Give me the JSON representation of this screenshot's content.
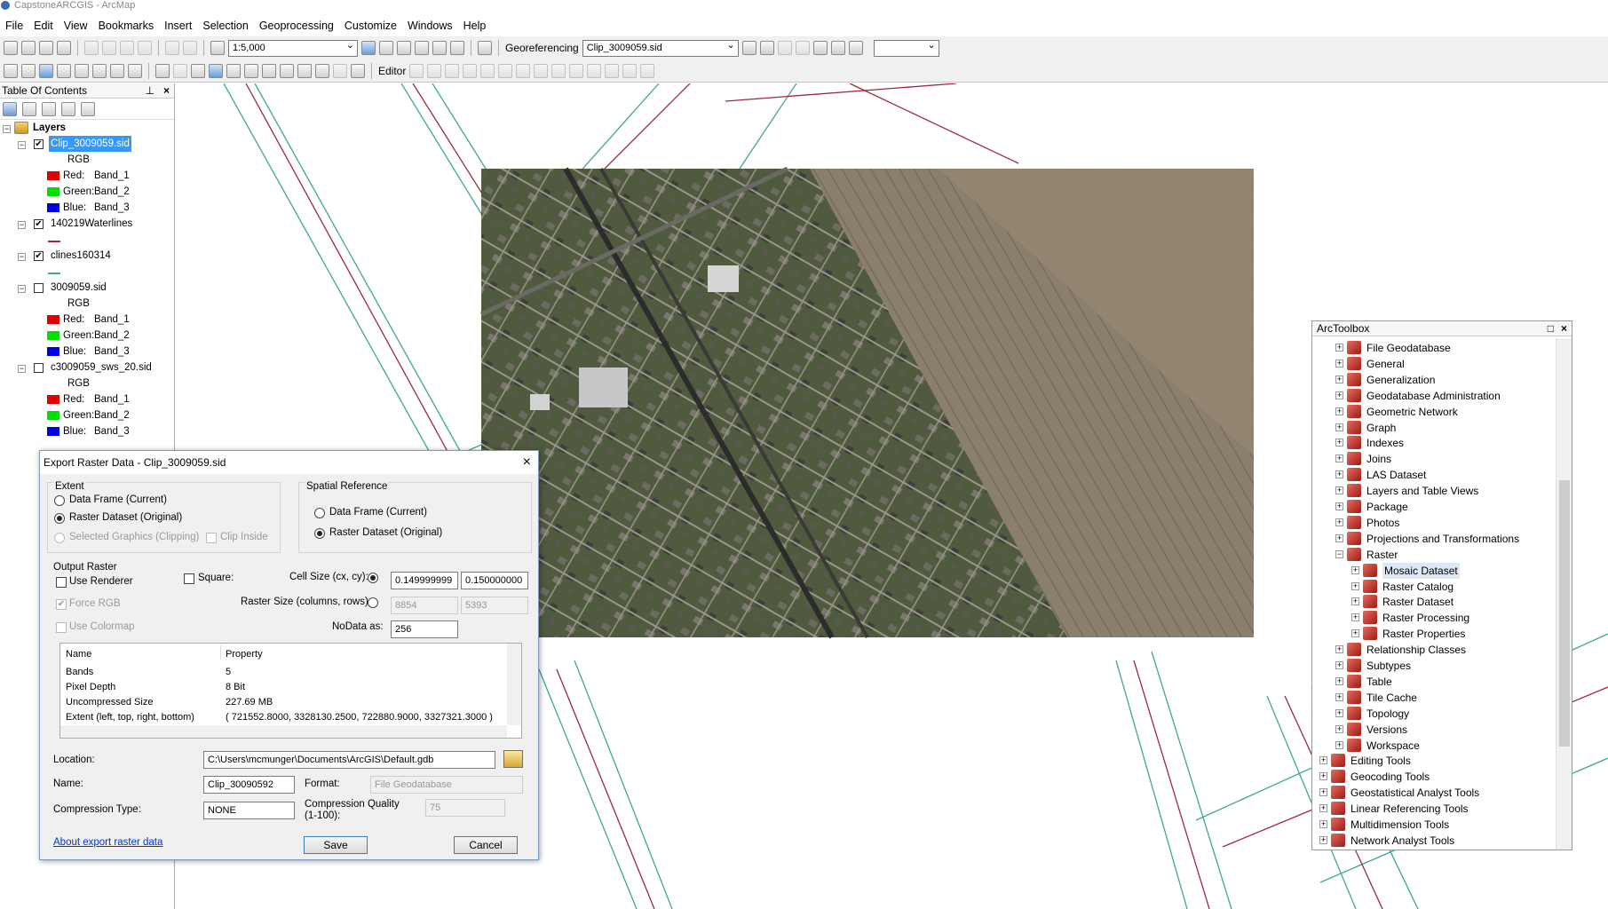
{
  "window": {
    "title": "CapstoneARCGIS - ArcMap"
  },
  "menu": [
    "File",
    "Edit",
    "View",
    "Bookmarks",
    "Insert",
    "Selection",
    "Geoprocessing",
    "Customize",
    "Windows",
    "Help"
  ],
  "toolbar": {
    "scale": "1:5,000",
    "georef_label": "Georeferencing",
    "georef_layer": "Clip_3009059.sid",
    "editor_label": "Editor"
  },
  "toc": {
    "title": "Table Of Contents",
    "root": "Layers",
    "layers": [
      {
        "name": "Clip_3009059.sid",
        "checked": true,
        "type": "RGB",
        "bands": [
          [
            "Red:",
            "Band_1"
          ],
          [
            "Green:",
            "Band_2"
          ],
          [
            "Blue:",
            "Band_3"
          ]
        ]
      },
      {
        "name": "140219Waterlines",
        "checked": true
      },
      {
        "name": "clines160314",
        "checked": true
      },
      {
        "name": "3009059.sid",
        "checked": false,
        "type": "RGB",
        "bands": [
          [
            "Red:",
            "Band_1"
          ],
          [
            "Green:",
            "Band_2"
          ],
          [
            "Blue:",
            "Band_3"
          ]
        ]
      },
      {
        "name": "c3009059_sws_20.sid",
        "checked": false,
        "type": "RGB",
        "bands": [
          [
            "Red:",
            "Band_1"
          ],
          [
            "Green:",
            "Band_2"
          ],
          [
            "Blue:",
            "Band_3"
          ]
        ]
      }
    ]
  },
  "dialog": {
    "title": "Export Raster Data - Clip_3009059.sid",
    "extent_label": "Extent",
    "extent_opt1": "Data Frame (Current)",
    "extent_opt2": "Raster Dataset (Original)",
    "extent_opt3": "Selected Graphics (Clipping)",
    "clip_inside": "Clip Inside",
    "sr_label": "Spatial Reference",
    "sr_opt1": "Data Frame (Current)",
    "sr_opt2": "Raster Dataset (Original)",
    "output_label": "Output Raster",
    "use_renderer": "Use Renderer",
    "square": "Square:",
    "cell_size_label": "Cell Size (cx, cy):",
    "cell_cx": "0.149999999",
    "cell_cy": "0.150000000",
    "force_rgb": "Force RGB",
    "raster_size_label": "Raster Size (columns, rows):",
    "cols": "8854",
    "rows": "5393",
    "use_colormap": "Use Colormap",
    "nodata_label": "NoData as:",
    "nodata": "256",
    "props_headers": [
      "Name",
      "Property"
    ],
    "props": [
      [
        "Bands",
        "5"
      ],
      [
        "Pixel Depth",
        "8 Bit"
      ],
      [
        "Uncompressed Size",
        "227.69 MB"
      ],
      [
        "Extent (left, top, right, bottom)",
        "( 721552.8000, 3328130.2500, 722880.9000, 3327321.3000 )"
      ]
    ],
    "location_label": "Location:",
    "location": "C:\\Users\\mcmunger\\Documents\\ArcGIS\\Default.gdb",
    "name_label": "Name:",
    "name": "Clip_30090592",
    "format_label": "Format:",
    "format": "File Geodatabase",
    "compression_label": "Compression Type:",
    "compression": "NONE",
    "quality_label": "Compression Quality (1-100):",
    "quality": "75",
    "help_link": "About export raster data",
    "save": "Save",
    "cancel": "Cancel"
  },
  "arctoolbox": {
    "title": "ArcToolbox",
    "items": [
      {
        "label": "File Geodatabase",
        "level": 1,
        "exp": "+"
      },
      {
        "label": "General",
        "level": 1,
        "exp": "+"
      },
      {
        "label": "Generalization",
        "level": 1,
        "exp": "+"
      },
      {
        "label": "Geodatabase Administration",
        "level": 1,
        "exp": "+"
      },
      {
        "label": "Geometric Network",
        "level": 1,
        "exp": "+"
      },
      {
        "label": "Graph",
        "level": 1,
        "exp": "+"
      },
      {
        "label": "Indexes",
        "level": 1,
        "exp": "+"
      },
      {
        "label": "Joins",
        "level": 1,
        "exp": "+"
      },
      {
        "label": "LAS Dataset",
        "level": 1,
        "exp": "+"
      },
      {
        "label": "Layers and Table Views",
        "level": 1,
        "exp": "+"
      },
      {
        "label": "Package",
        "level": 1,
        "exp": "+"
      },
      {
        "label": "Photos",
        "level": 1,
        "exp": "+"
      },
      {
        "label": "Projections and Transformations",
        "level": 1,
        "exp": "+"
      },
      {
        "label": "Raster",
        "level": 1,
        "exp": "−"
      },
      {
        "label": "Mosaic Dataset",
        "level": 2,
        "exp": "+",
        "hl": true
      },
      {
        "label": "Raster Catalog",
        "level": 2,
        "exp": "+"
      },
      {
        "label": "Raster Dataset",
        "level": 2,
        "exp": "+"
      },
      {
        "label": "Raster Processing",
        "level": 2,
        "exp": "+"
      },
      {
        "label": "Raster Properties",
        "level": 2,
        "exp": "+"
      },
      {
        "label": "Relationship Classes",
        "level": 1,
        "exp": "+"
      },
      {
        "label": "Subtypes",
        "level": 1,
        "exp": "+"
      },
      {
        "label": "Table",
        "level": 1,
        "exp": "+"
      },
      {
        "label": "Tile Cache",
        "level": 1,
        "exp": "+"
      },
      {
        "label": "Topology",
        "level": 1,
        "exp": "+"
      },
      {
        "label": "Versions",
        "level": 1,
        "exp": "+"
      },
      {
        "label": "Workspace",
        "level": 1,
        "exp": "+"
      },
      {
        "label": "Editing Tools",
        "level": 0,
        "exp": "+"
      },
      {
        "label": "Geocoding Tools",
        "level": 0,
        "exp": "+"
      },
      {
        "label": "Geostatistical Analyst Tools",
        "level": 0,
        "exp": "+"
      },
      {
        "label": "Linear Referencing Tools",
        "level": 0,
        "exp": "+"
      },
      {
        "label": "Multidimension Tools",
        "level": 0,
        "exp": "+"
      },
      {
        "label": "Network Analyst Tools",
        "level": 0,
        "exp": "+"
      }
    ]
  },
  "colors": {
    "waterline": "#3aa89a",
    "cline": "#a0283a",
    "selection": "#3399ff",
    "band_red": "#e00000",
    "band_green": "#00e000",
    "band_blue": "#0000e0"
  }
}
